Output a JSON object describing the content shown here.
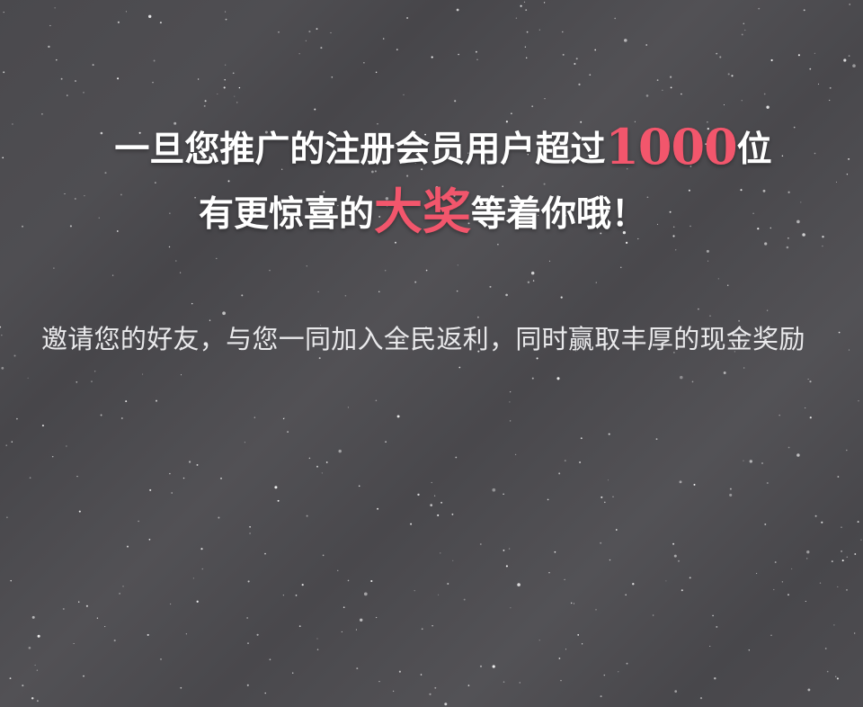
{
  "promo": {
    "line1_before": "一旦您推广的注册会员用户超过",
    "line1_highlight": "1000",
    "line1_after": "位",
    "line2_before": "有更惊喜的",
    "line2_highlight": "大奖",
    "line2_after": "等着你哦！",
    "description": "邀请您的好友，与您一同加入全民返利，同时赢取丰厚的现金奖励"
  },
  "colors": {
    "background": "#4d4c50",
    "highlight": "#f2566c",
    "text": "#ffffff"
  }
}
